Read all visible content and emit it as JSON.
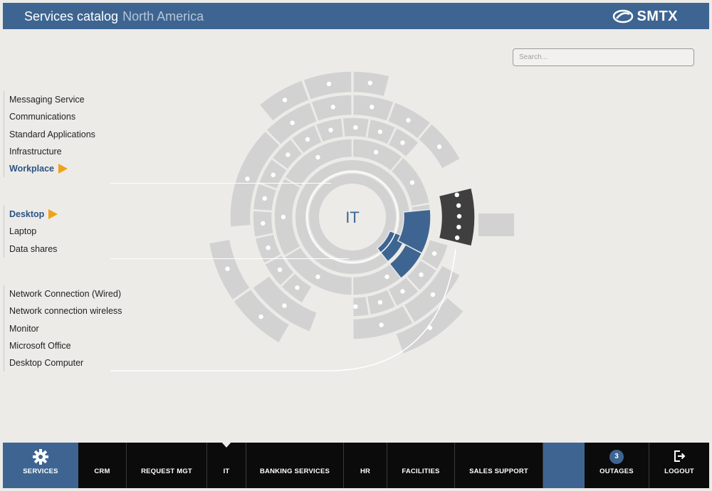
{
  "header": {
    "title": "Services catalog",
    "region": "North America",
    "logo_text": "SMTX",
    "color": "#3e6591"
  },
  "search": {
    "placeholder": "Search..."
  },
  "level1": {
    "items": [
      {
        "label": "Messaging Service",
        "active": false
      },
      {
        "label": "Communications",
        "active": false
      },
      {
        "label": "Standard Applications",
        "active": false
      },
      {
        "label": "Infrastructure",
        "active": false
      },
      {
        "label": "Workplace",
        "active": true
      }
    ]
  },
  "level2": {
    "items": [
      {
        "label": "Desktop",
        "active": true
      },
      {
        "label": "Laptop",
        "active": false
      },
      {
        "label": "Data shares",
        "active": false
      }
    ]
  },
  "level3": {
    "items": [
      {
        "label": "Network Connection (Wired)",
        "active": false
      },
      {
        "label": "Network connection wireless",
        "active": false
      },
      {
        "label": "Monitor",
        "active": false
      },
      {
        "label": "Microsoft Office",
        "active": false
      },
      {
        "label": "Desktop Computer",
        "active": false
      }
    ]
  },
  "sunburst": {
    "center_label": "IT",
    "selected_color": "#3e6591",
    "highlight_color": "#3f3f3f",
    "segment_color": "#d2d2d2"
  },
  "nav": {
    "items": [
      {
        "label": "SERVICES",
        "icon": "gear-icon"
      },
      {
        "label": "CRM"
      },
      {
        "label": "REQUEST MGT"
      },
      {
        "label": "IT",
        "active": true
      },
      {
        "label": "BANKING SERVICES"
      },
      {
        "label": "HR"
      },
      {
        "label": "FACILITIES"
      },
      {
        "label": "SALES SUPPORT"
      },
      {
        "label": ""
      },
      {
        "label": "OUTAGES",
        "badge": "3"
      },
      {
        "label": "LOGOUT",
        "icon": "logout-icon"
      }
    ]
  }
}
